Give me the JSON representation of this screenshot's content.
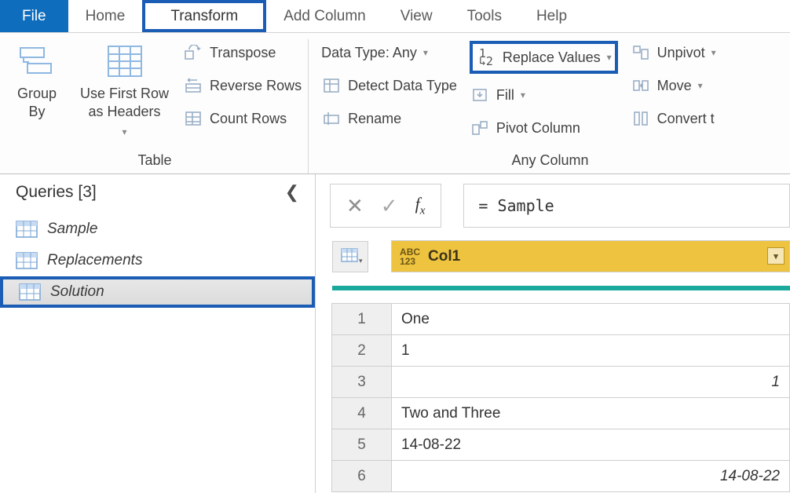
{
  "tabs": {
    "file": "File",
    "home": "Home",
    "transform": "Transform",
    "addColumn": "Add Column",
    "view": "View",
    "tools": "Tools",
    "help": "Help"
  },
  "ribbon": {
    "table": {
      "groupBy": "Group\nBy",
      "useFirstRow": "Use First Row\nas Headers",
      "transpose": "Transpose",
      "reverseRows": "Reverse Rows",
      "countRows": "Count Rows",
      "label": "Table"
    },
    "anyColumn": {
      "dataType": "Data Type: Any",
      "detect": "Detect Data Type",
      "rename": "Rename",
      "replaceValues": "Replace Values",
      "fill": "Fill",
      "pivotColumn": "Pivot Column",
      "unpivot": "Unpivot",
      "move": "Move",
      "convert": "Convert t",
      "label": "Any Column"
    }
  },
  "sidebar": {
    "header": "Queries [3]",
    "items": [
      {
        "label": "Sample"
      },
      {
        "label": "Replacements"
      },
      {
        "label": "Solution"
      }
    ]
  },
  "formula": "= Sample",
  "table": {
    "col1Header": "Col1",
    "rows": [
      {
        "num": "1",
        "value": "One",
        "align": "left"
      },
      {
        "num": "2",
        "value": "1",
        "align": "left"
      },
      {
        "num": "3",
        "value": "1",
        "align": "right"
      },
      {
        "num": "4",
        "value": "Two and Three",
        "align": "left"
      },
      {
        "num": "5",
        "value": "14-08-22",
        "align": "left"
      },
      {
        "num": "6",
        "value": "14-08-22",
        "align": "right"
      }
    ]
  }
}
